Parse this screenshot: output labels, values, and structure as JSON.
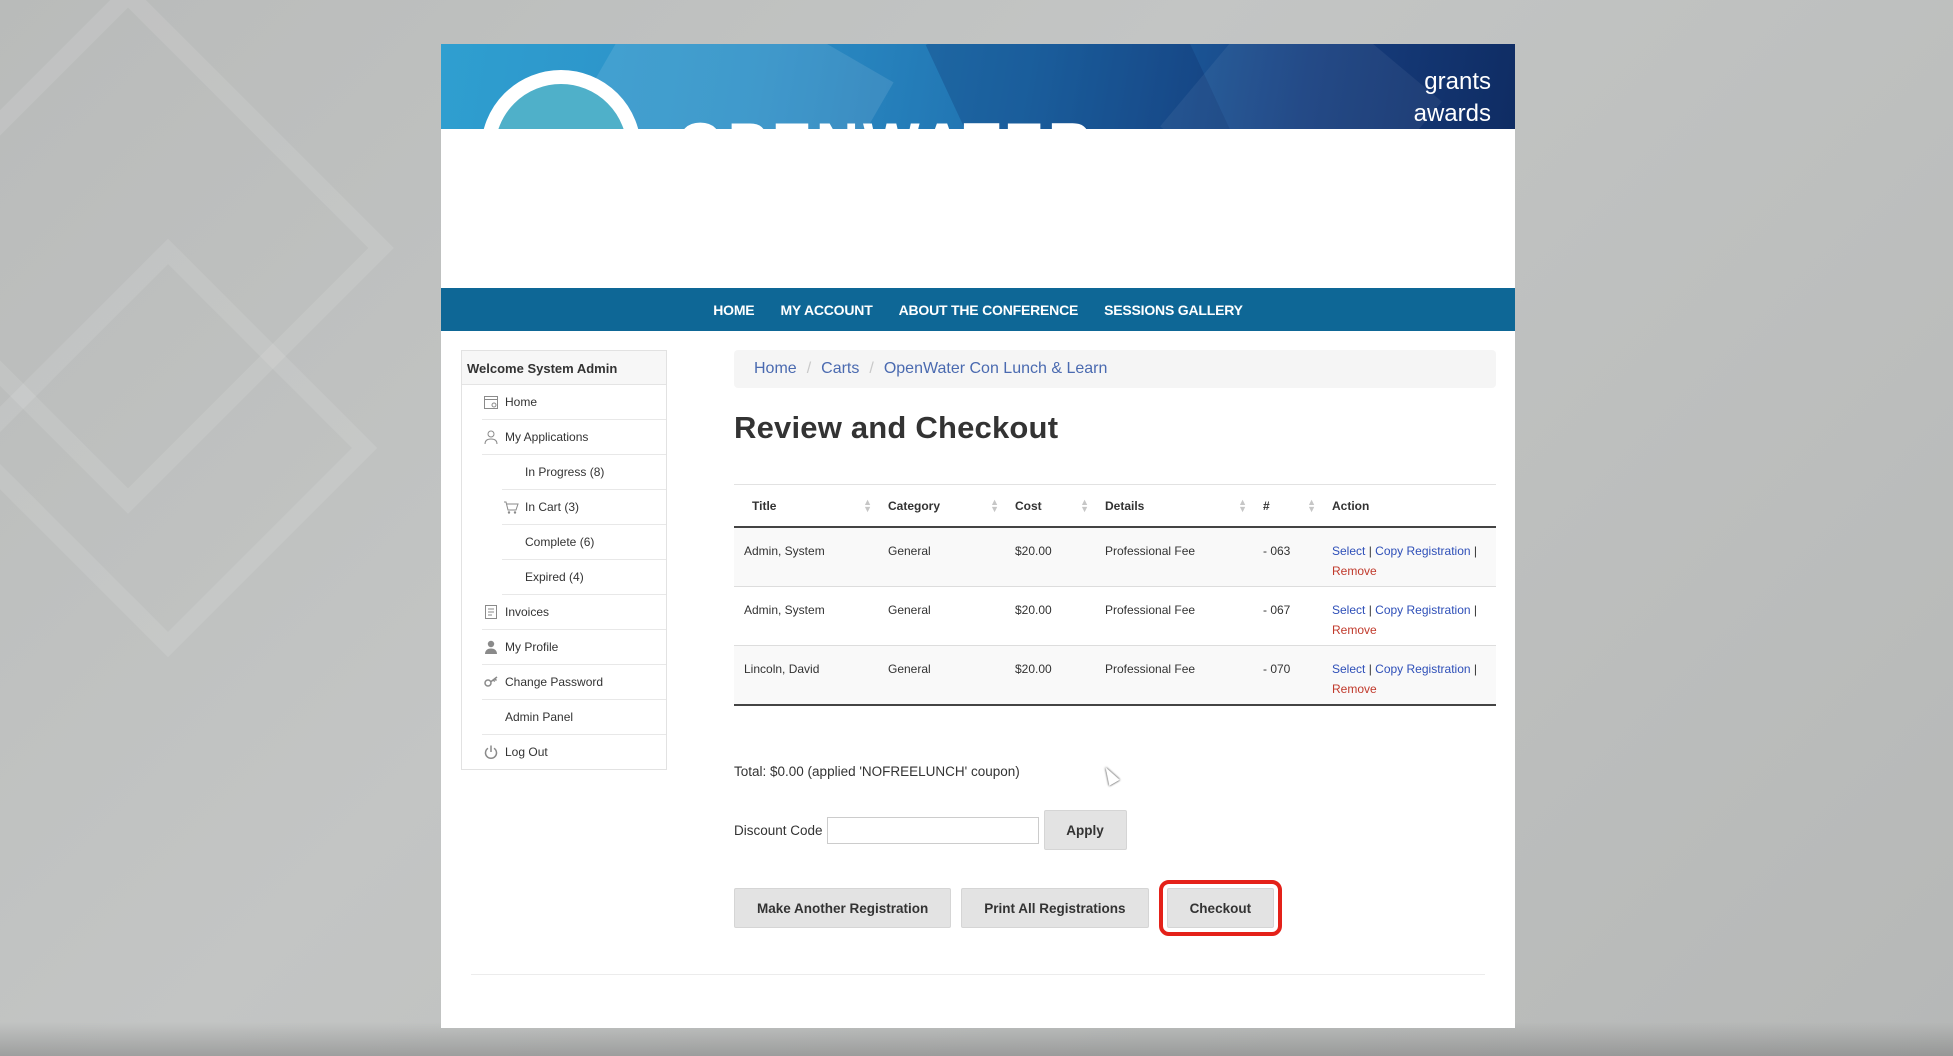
{
  "banner": {
    "logo_text": "OPENWATER",
    "tagline_line1": "grants",
    "tagline_line2": "awards"
  },
  "nav": {
    "items": [
      "HOME",
      "MY ACCOUNT",
      "ABOUT THE CONFERENCE",
      "SESSIONS GALLERY"
    ]
  },
  "sidebar": {
    "welcome": "Welcome System Admin",
    "items": [
      {
        "label": "Home",
        "icon": "calendar-icon"
      },
      {
        "label": "My Applications",
        "icon": "user-gear-icon"
      },
      {
        "label": "In Progress (8)",
        "icon": ""
      },
      {
        "label": "In Cart (3)",
        "icon": "cart-icon"
      },
      {
        "label": "Complete (6)",
        "icon": ""
      },
      {
        "label": "Expired (4)",
        "icon": ""
      },
      {
        "label": "Invoices",
        "icon": "invoice-icon"
      },
      {
        "label": "My Profile",
        "icon": "person-icon"
      },
      {
        "label": "Change Password",
        "icon": "key-icon"
      },
      {
        "label": "Admin Panel",
        "icon": ""
      },
      {
        "label": "Log Out",
        "icon": "power-icon"
      }
    ]
  },
  "breadcrumb": [
    "Home",
    "Carts",
    "OpenWater Con Lunch & Learn"
  ],
  "page_title": "Review and Checkout",
  "table": {
    "headers": [
      "Title",
      "Category",
      "Cost",
      "Details",
      "#",
      "Action"
    ],
    "rows": [
      {
        "title": "Admin, System",
        "category": "General",
        "cost": "$20.00",
        "details": "Professional Fee",
        "number": "- 063"
      },
      {
        "title": "Admin, System",
        "category": "General",
        "cost": "$20.00",
        "details": "Professional Fee",
        "number": "- 067"
      },
      {
        "title": "Lincoln, David",
        "category": "General",
        "cost": "$20.00",
        "details": "Professional Fee",
        "number": "- 070"
      }
    ],
    "action_select": "Select",
    "action_copy": "Copy Registration",
    "action_remove": "Remove",
    "action_sep": "|"
  },
  "total_text": "Total: $0.00 (applied 'NOFREELUNCH' coupon)",
  "discount": {
    "label": "Discount Code",
    "value": "",
    "apply_label": "Apply"
  },
  "buttons": {
    "make_another": "Make Another Registration",
    "print_all": "Print All Registrations",
    "checkout": "Checkout"
  },
  "colors": {
    "nav_bg": "#0e6796",
    "link": "#2e4fb8",
    "remove": "#c0392b",
    "highlight": "#e42119"
  }
}
